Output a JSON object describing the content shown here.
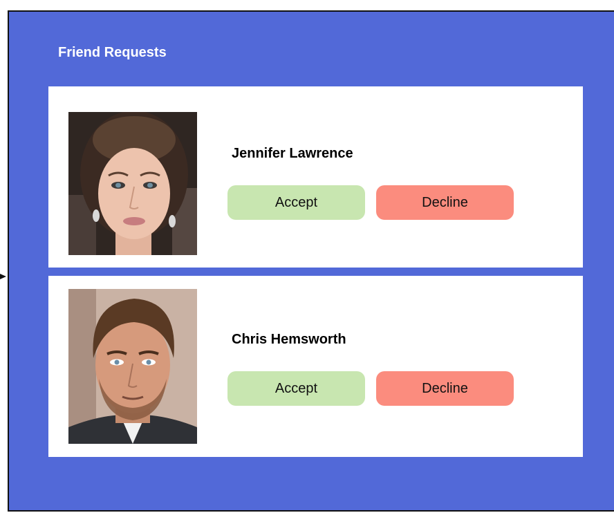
{
  "panel": {
    "title": "Friend Requests",
    "background_color": "#5269d8"
  },
  "requests": [
    {
      "name": "Jennifer Lawrence",
      "avatar_icon": "profile-photo",
      "accept_label": "Accept",
      "decline_label": "Decline"
    },
    {
      "name": "Chris Hemsworth",
      "avatar_icon": "profile-photo",
      "accept_label": "Accept",
      "decline_label": "Decline"
    }
  ],
  "colors": {
    "accept": "#c8e6b0",
    "decline": "#fb8c7e",
    "card": "#ffffff"
  }
}
